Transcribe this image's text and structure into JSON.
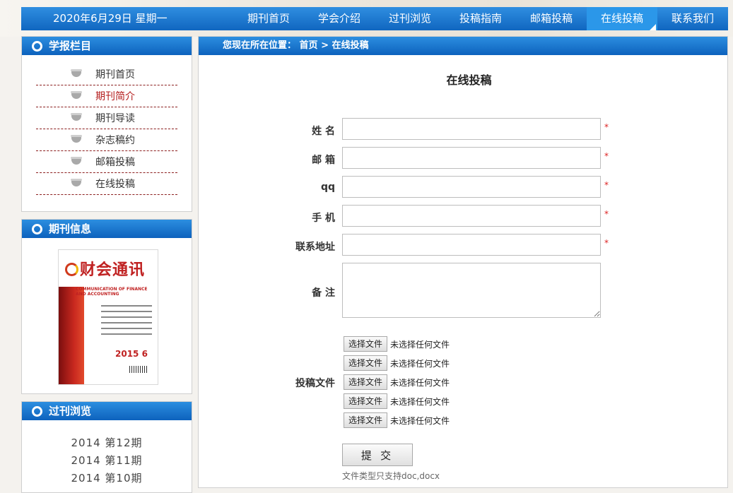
{
  "header": {
    "date": "2020年6月29日 星期一",
    "nav": [
      "期刊首页",
      "学会介绍",
      "过刊浏览",
      "投稿指南",
      "邮箱投稿",
      "在线投稿",
      "联系我们"
    ],
    "active_index": 5
  },
  "sidebar": {
    "column_title": "学报栏目",
    "menu": [
      "期刊首页",
      "期刊简介",
      "期刊导读",
      "杂志稿约",
      "邮箱投稿",
      "在线投稿"
    ],
    "active_menu": "期刊简介",
    "info_title": "期刊信息",
    "cover": {
      "logo_text": "财会通讯",
      "caption": "COMMUNICATION OF FINANCE AND ACCOUNTING",
      "year": "2015 6"
    },
    "archive_title": "过刊浏览",
    "issues": [
      "2014 第12期",
      "2014 第11期",
      "2014 第10期"
    ]
  },
  "main": {
    "breadcrumb_prefix": "您现在所在位置：",
    "breadcrumb": "首页 > 在线投稿",
    "title": "在线投稿",
    "labels": {
      "name": "姓 名",
      "email": "邮 箱",
      "qq": "qq",
      "phone": "手 机",
      "address": "联系地址",
      "remark": "备 注",
      "files": "投稿文件"
    },
    "required_mark": "*",
    "file_button": "选择文件",
    "file_status": "未选择任何文件",
    "submit": "提 交",
    "note": "文件类型只支持doc,docx"
  },
  "colors": {
    "nav_blue": "#1066c0",
    "active_tab": "#2b97e9",
    "active_menu": "#b31b1b",
    "required": "#dd2222"
  }
}
